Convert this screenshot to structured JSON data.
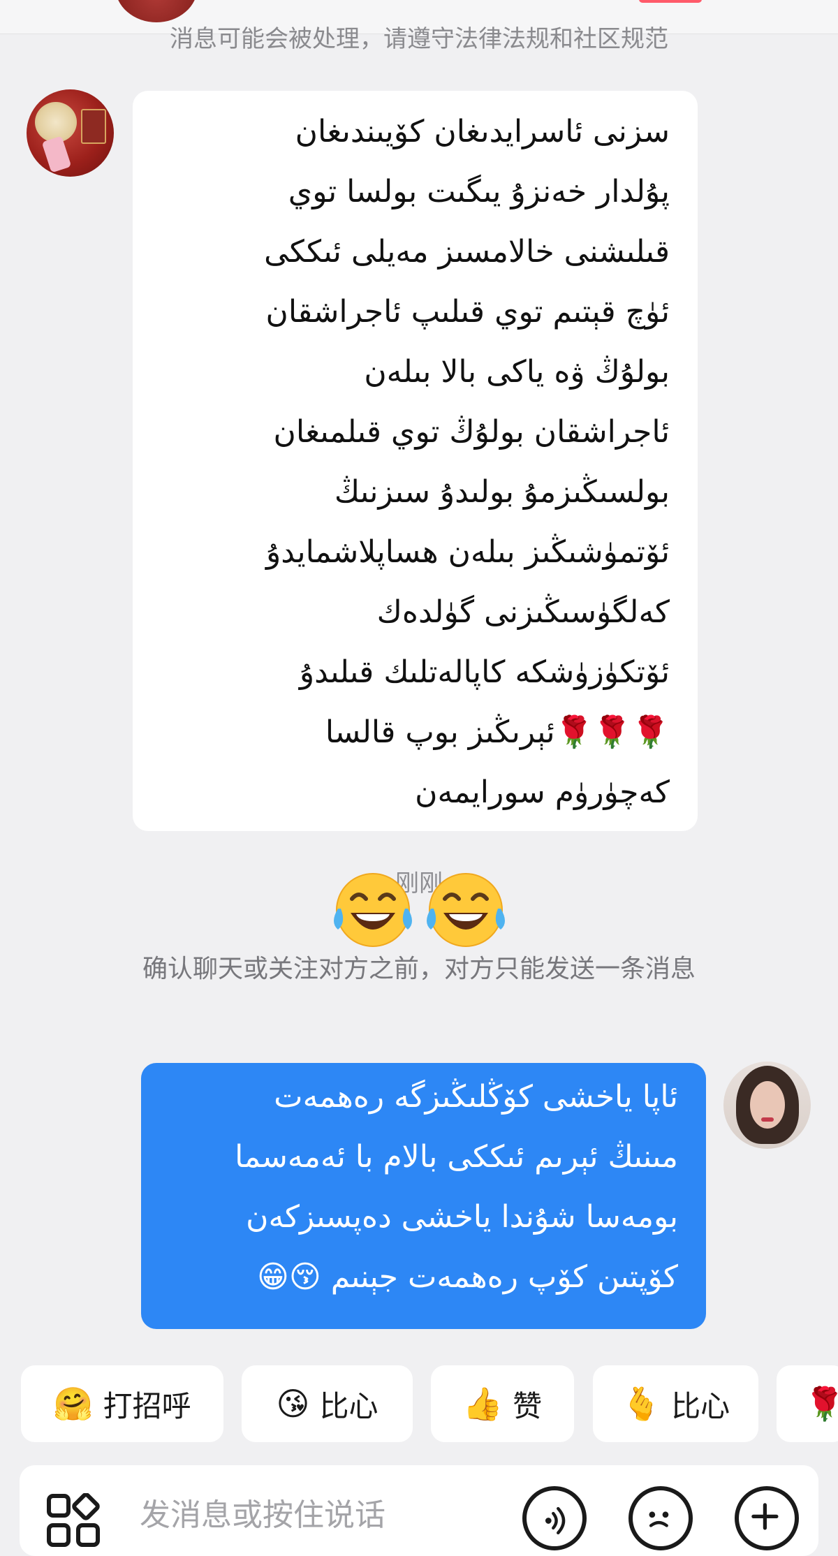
{
  "header": {
    "cut_notice": "消息可能会被处理，请遵守法律法规和社区规范"
  },
  "messages": {
    "incoming": {
      "lines": [
        "سزنى ئاسرايدىغان كۆيىندىغان",
        "پۇلدار خەنزۇ يىگىت بولسا توي",
        "قىلىشنى خالامسىز مەيلى ئىككى",
        "ئۈچ قېتىم توي  قىلىپ ئاجراشقان",
        "بولۇڭ ۋە ياكى بالا بىلەن",
        "ئاجراشقان بولۇڭ توي قىلمىغان",
        "بولسىڭىزمۇ بولىدۇ سىزنىڭ",
        "ئۆتمۈشىڭىز بىلەن ھساپلاشمايدۇ",
        "كەلگۈسىڭىزنى گۈلدەك",
        "ئۆتكۈزۈشكە كاپالەتلىك قىلىدۇ",
        "🌹🌹🌹ئېرىڭىز بوپ قالسا",
        "كەچۈرۈم سورايمەن"
      ]
    },
    "timestamp": "刚刚",
    "reaction_emojis": [
      "face-with-tears-of-joy",
      "face-with-tears-of-joy"
    ],
    "system_notice": "确认聊天或关注对方之前，对方只能发送一条消息",
    "outgoing": {
      "lines": [
        "ئاپا ياخشى كۆڭلىڭىزگە رەھمەت",
        "مىنىڭ ئېرىم ئىككى بالام با ئەمەسما",
        "بومەسا شۇندا ياخشى دەپسىزكەن",
        "كۆپتىن كۆپ رەھمەت جېنىم 😚😁"
      ]
    }
  },
  "quick_replies": [
    {
      "icon": "🤗",
      "label": "打招呼"
    },
    {
      "icon": "😘",
      "label": "比心"
    },
    {
      "icon": "👍",
      "label": "赞"
    },
    {
      "icon": "🫰",
      "label": "比心"
    },
    {
      "icon": "🌹",
      "label": ""
    }
  ],
  "composer": {
    "placeholder": "发消息或按住说话"
  },
  "icons": {
    "apps": "apps-icon",
    "voice": "voice-icon",
    "emoji": "emoji-icon",
    "plus": "plus-icon"
  },
  "colors": {
    "outgoing_bubble": "#2d87f5",
    "incoming_bubble": "#ffffff",
    "background": "#f0f0f2"
  }
}
